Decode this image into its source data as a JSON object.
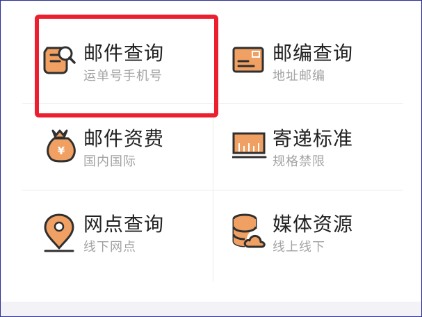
{
  "tiles": [
    {
      "title": "邮件查询",
      "subtitle": "运单号手机号",
      "icon": "mail-search-icon"
    },
    {
      "title": "邮编查询",
      "subtitle": "地址邮编",
      "icon": "postcode-card-icon"
    },
    {
      "title": "邮件资费",
      "subtitle": "国内国际",
      "icon": "money-bag-icon"
    },
    {
      "title": "寄递标准",
      "subtitle": "规格禁限",
      "icon": "ruler-scale-icon"
    },
    {
      "title": "网点查询",
      "subtitle": "线下网点",
      "icon": "location-pin-icon"
    },
    {
      "title": "媒体资源",
      "subtitle": "线上线下",
      "icon": "database-cloud-icon"
    }
  ],
  "colors": {
    "icon_orange": "#f0a062",
    "icon_dark": "#2f2f2f",
    "highlight_red": "#ec1f2e",
    "title_text": "#222222",
    "subtitle_text": "#a3a3a3"
  }
}
